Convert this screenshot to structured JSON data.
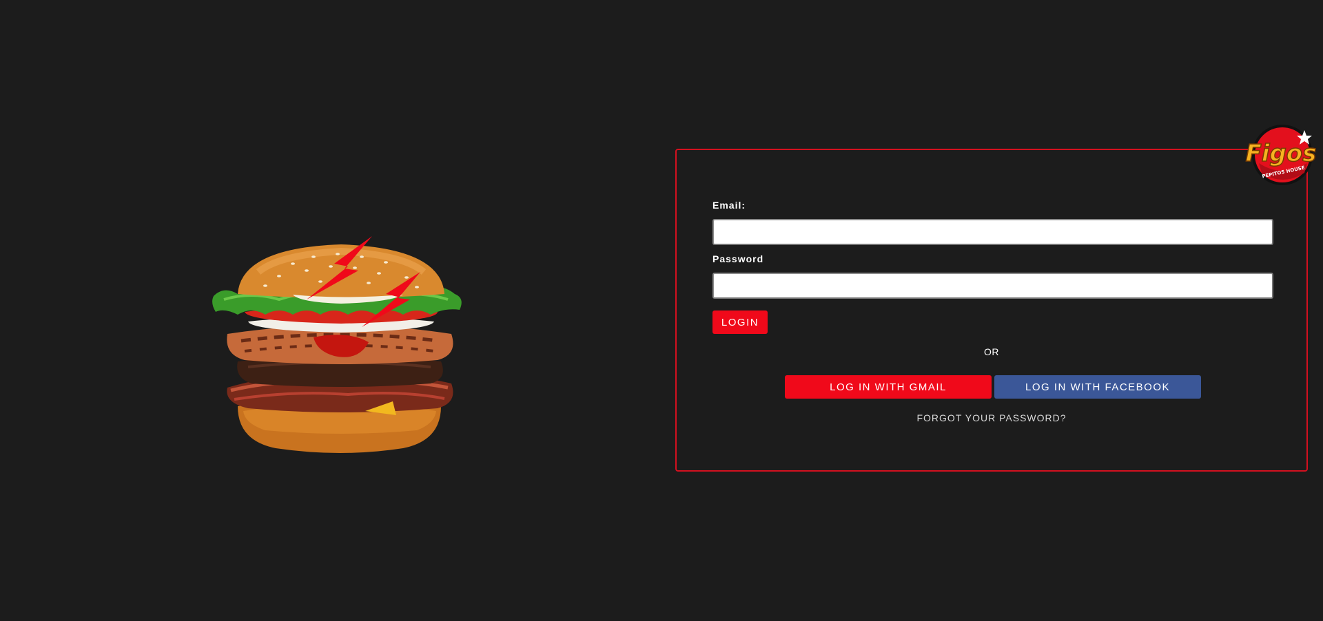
{
  "hero": {
    "image": "burger-with-lightning-bolts"
  },
  "logo": {
    "text": "Figos",
    "tagline": "PEPITOS HOUSE"
  },
  "login_form": {
    "email_label": "Email:",
    "email_value": "",
    "password_label": "Password",
    "password_value": "",
    "login_label": "LOGIN",
    "or_text": "OR",
    "gmail_label": "LOG IN WITH GMAIL",
    "facebook_label": "LOG IN WITH FACEBOOK",
    "forgot_label": "FORGOT YOUR PASSWORD?"
  },
  "colors": {
    "background": "#1c1c1c",
    "accent_red": "#f0091a",
    "facebook_blue": "#3b5798",
    "card_border": "#d4101f"
  }
}
